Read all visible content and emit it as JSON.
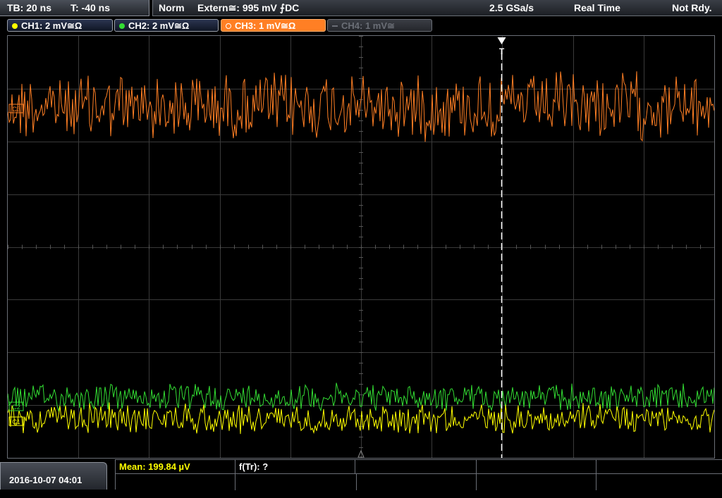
{
  "topbar": {
    "timebase": "TB: 20 ns",
    "trigger_time": "T: -40 ns",
    "mode": "Norm",
    "trigger_source": "Extern≅: 995 mV ⨍DC",
    "sample_rate": "2.5 GSa/s",
    "acq_mode": "Real Time",
    "status": "Not Rdy."
  },
  "channels": [
    {
      "label": "CH1: 2 mV≅Ω",
      "color": "#ffff00",
      "state": "on"
    },
    {
      "label": "CH2: 2 mV≅Ω",
      "color": "#33dd33",
      "state": "on"
    },
    {
      "label": "CH3: 1 mV≅Ω",
      "color": "#ff7f24",
      "state": "active"
    },
    {
      "label": "CH4: 1 mV≅",
      "color": "#6a6e76",
      "state": "off"
    }
  ],
  "markers": {
    "trigger": "T",
    "ch3_marker": "C3",
    "ch2_marker": "C2",
    "ch1_marker": "C1"
  },
  "bottom": {
    "datetime": "2016-10-07 04:01",
    "meas1": "Mean: 199.84 µV",
    "meas2": "f(Tr): ?"
  },
  "colors": {
    "grid": "#3a3a3a",
    "ch1": "#ffff00",
    "ch2": "#33dd33",
    "ch3": "#ff7f24"
  }
}
